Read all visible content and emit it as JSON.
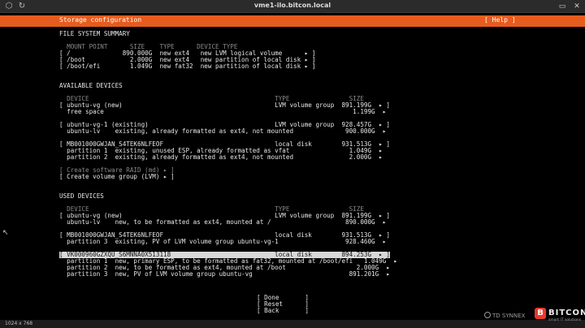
{
  "window": {
    "title": "vme1-ilo.bitcon.local",
    "resolution": "1024 x 768",
    "icons": [
      "hp-logo-icon",
      "sync-icon",
      "window-icon",
      "close-icon"
    ]
  },
  "header": {
    "title": "Storage configuration",
    "help": "[ Help ]",
    "color": "#e65c1e"
  },
  "fs_summary": {
    "heading": "FILE SYSTEM SUMMARY",
    "columns": "  MOUNT POINT      SIZE    TYPE      DEVICE TYPE",
    "rows": [
      "[ /              890.000G  new ext4   new LVM logical volume      ▸ ]",
      "[ /boot            2.000G  new ext4   new partition of local disk ▸ ]",
      "[ /boot/efi        1.049G  new fat32  new partition of local disk ▸ ]"
    ]
  },
  "available": {
    "heading": "AVAILABLE DEVICES",
    "columns": "  DEVICE                                                  TYPE                SIZE",
    "groups": [
      [
        "[ ubuntu-vg (new)                                         LVM volume group  891.199G  ▸ ]",
        "  free space                                                                   1.199G  ▸"
      ],
      [
        "[ ubuntu-vg-1 (existing)                                  LVM volume group  928.457G  ▸ ]",
        "  ubuntu-lv    existing, already formatted as ext4, not mounted              900.000G  ▸"
      ],
      [
        "[ MB001000GWJAN_S4TEK6NLFEOF                              local disk        931.513G  ▸ ]",
        "  partition 1  existing, unused ESP, already formatted as vfat                1.049G  ▸",
        "  partition 2  existing, already formatted as ext4, not mounted               2.000G  ▸"
      ]
    ],
    "actions": [
      "[ Create software RAID (md) ▸ ]",
      "[ Create volume group (LVM) ▸ ]"
    ]
  },
  "used": {
    "heading": "USED DEVICES",
    "columns": "  DEVICE                                                  TYPE                SIZE",
    "rows": [
      "[ ubuntu-vg (new)                                         LVM volume group  891.199G  ▸ ]",
      "  ubuntu-lv    new, to be formatted as ext4, mounted at /                    890.000G  ▸",
      "[ MB001000GWJAN_S4TEK6NLFEOF                              local disk        931.513G  ▸ ]",
      "  partition 3  existing, PV of LVM volume group ubuntu-vg-1                  928.460G  ▸",
      "[ VK000960GZXQU_S6MNNA0X513118                            local disk        894.253G  ▸ ]",
      "  partition 1  new, primary ESP, to be formatted as fat32, mounted at /boot/efi   1.049G  ▸",
      "  partition 2  new, to be formatted as ext4, mounted at /boot                   2.000G  ▸",
      "  partition 3  new, PV of LVM volume group ubuntu-vg                          891.201G  ▸"
    ]
  },
  "buttons": {
    "done": "[ Done       ]",
    "reset": "[ Reset      ]",
    "back": "[ Back       ]"
  },
  "watermarks": {
    "td": "TD SYNNEX",
    "bitcon_name": "BITCON",
    "bitcon_tag": "smart IT solutions"
  }
}
